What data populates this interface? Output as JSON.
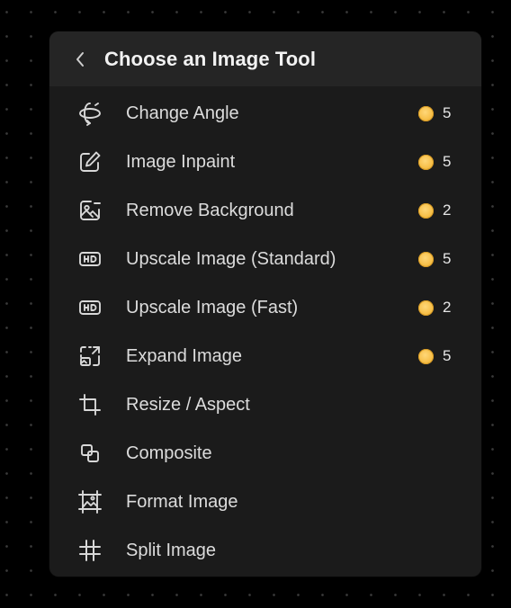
{
  "header": {
    "title": "Choose an Image Tool"
  },
  "tools": [
    {
      "label": "Change Angle",
      "icon": "rotate-3d-icon",
      "cost": "5"
    },
    {
      "label": "Image Inpaint",
      "icon": "edit-pencil-icon",
      "cost": "5"
    },
    {
      "label": "Remove Background",
      "icon": "image-remove-icon",
      "cost": "2"
    },
    {
      "label": "Upscale Image (Standard)",
      "icon": "hd-icon",
      "cost": "5"
    },
    {
      "label": "Upscale Image (Fast)",
      "icon": "hd-icon",
      "cost": "2"
    },
    {
      "label": "Expand Image",
      "icon": "expand-image-icon",
      "cost": "5"
    },
    {
      "label": "Resize / Aspect",
      "icon": "crop-icon",
      "cost": null
    },
    {
      "label": "Composite",
      "icon": "composite-squares-icon",
      "cost": null
    },
    {
      "label": "Format Image",
      "icon": "format-frame-icon",
      "cost": null
    },
    {
      "label": "Split Image",
      "icon": "grid-hash-icon",
      "cost": null
    }
  ],
  "colors": {
    "panel_bg": "#1b1b1b",
    "header_bg": "#252525",
    "coin": "#f7c04a",
    "text": "#dcdcdc"
  }
}
